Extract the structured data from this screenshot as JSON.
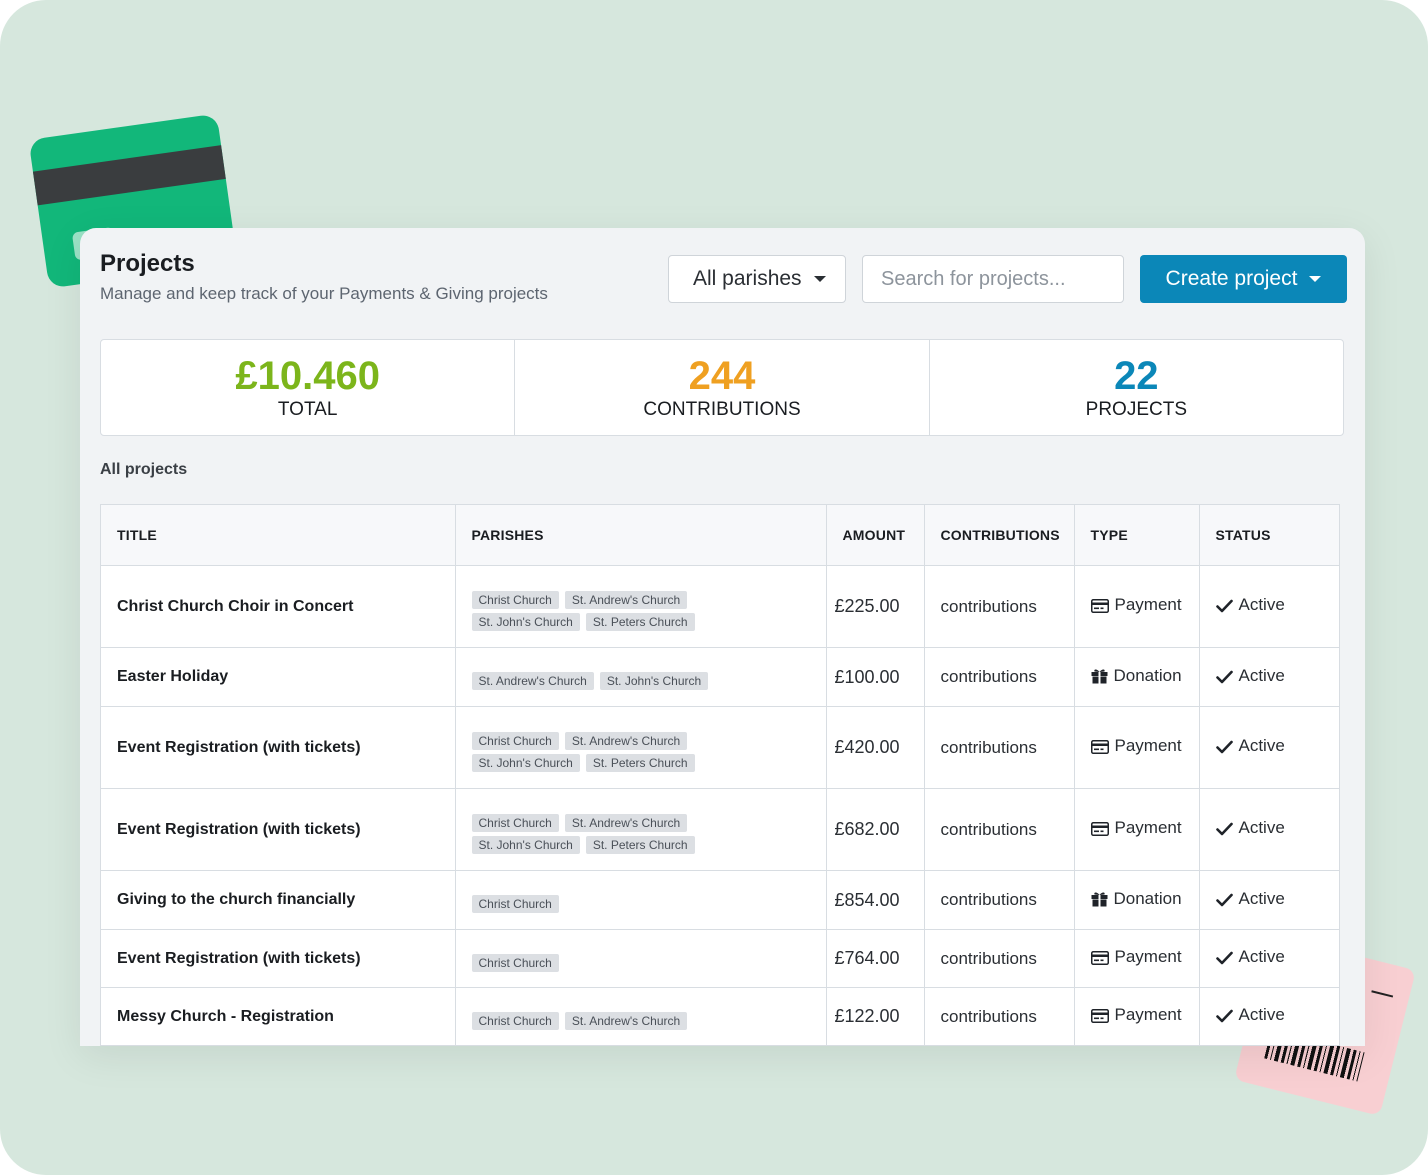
{
  "header": {
    "title": "Projects",
    "subtitle": "Manage and keep track of your Payments & Giving projects"
  },
  "toolbar": {
    "parish_filter": "All parishes",
    "search_placeholder": "Search for projects...",
    "create_label": "Create project"
  },
  "stats": [
    {
      "value": "£10.460",
      "label": "TOTAL",
      "color": "#7cb51b"
    },
    {
      "value": "244",
      "label": "CONTRIBUTIONS",
      "color": "#efa021"
    },
    {
      "value": "22",
      "label": "PROJECTS",
      "color": "#0b87b8"
    }
  ],
  "section_title": "All projects",
  "table": {
    "columns": [
      "TITLE",
      "PARISHES",
      "AMOUNT",
      "CONTRIBUTIONS",
      "TYPE",
      "STATUS"
    ],
    "rows": [
      {
        "title": "Christ Church Choir in Concert",
        "parishes": [
          "Christ Church",
          "St. Andrew's Church",
          "St. John's Church",
          "St. Peters Church"
        ],
        "amount": "£225.00",
        "contributions": "contributions",
        "type": "Payment",
        "type_icon": "credit-card-icon",
        "status": "Active"
      },
      {
        "title": "Easter Holiday",
        "parishes": [
          "St. Andrew's Church",
          "St. John's Church"
        ],
        "amount": "£100.00",
        "contributions": "contributions",
        "type": "Donation",
        "type_icon": "gift-icon",
        "status": "Active"
      },
      {
        "title": "Event Registration (with tickets)",
        "parishes": [
          "Christ Church",
          "St. Andrew's Church",
          "St. John's Church",
          "St. Peters Church"
        ],
        "amount": "£420.00",
        "contributions": "contributions",
        "type": "Payment",
        "type_icon": "credit-card-icon",
        "status": "Active"
      },
      {
        "title": "Event Registration (with tickets)",
        "parishes": [
          "Christ Church",
          "St. Andrew's Church",
          "St. John's Church",
          "St. Peters Church"
        ],
        "amount": "£682.00",
        "contributions": "contributions",
        "type": "Payment",
        "type_icon": "credit-card-icon",
        "status": "Active"
      },
      {
        "title": "Giving to the church financially",
        "parishes": [
          "Christ Church"
        ],
        "amount": "£854.00",
        "contributions": "contributions",
        "type": "Donation",
        "type_icon": "gift-icon",
        "status": "Active"
      },
      {
        "title": "Event Registration (with tickets)",
        "parishes": [
          "Christ Church"
        ],
        "amount": "£764.00",
        "contributions": "contributions",
        "type": "Payment",
        "type_icon": "credit-card-icon",
        "status": "Active"
      },
      {
        "title": "Messy Church - Registration",
        "parishes": [
          "Christ Church",
          "St. Andrew's Church"
        ],
        "amount": "£122.00",
        "contributions": "contributions",
        "type": "Payment",
        "type_icon": "credit-card-icon",
        "status": "Active"
      }
    ]
  }
}
